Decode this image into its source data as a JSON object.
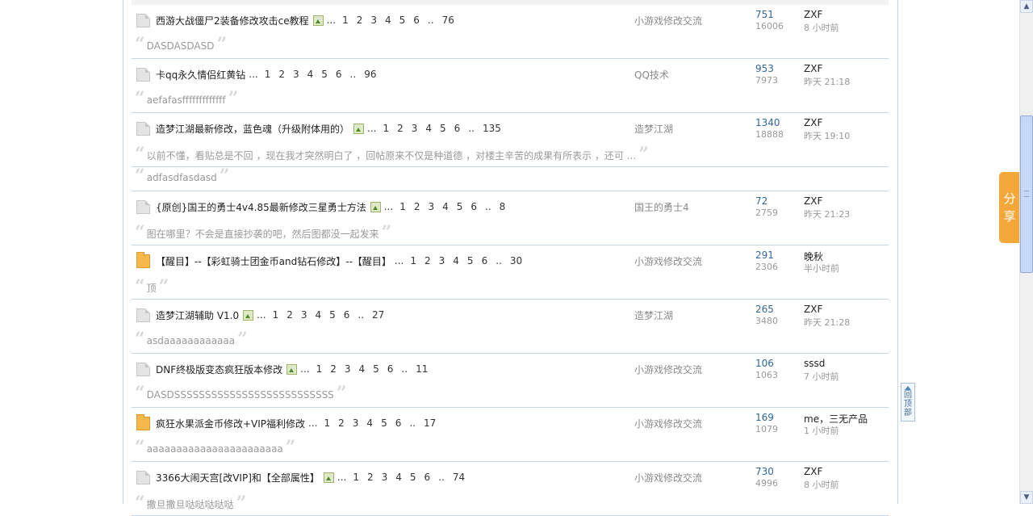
{
  "threads": [
    {
      "title": "西游大战僵尸2装备修改攻击ce教程",
      "has_image": true,
      "pages": [
        "1",
        "2",
        "3",
        "4",
        "5",
        "6",
        "..",
        "76"
      ],
      "forum": "小游戏修改交流",
      "replies": "751",
      "views": "16006",
      "author": "ZXF",
      "time": "8 小时前",
      "icon": "normal",
      "quote": "DASDASDASD"
    },
    {
      "title": "卡qq永久情侣红黄钻",
      "has_image": false,
      "pages": [
        "1",
        "2",
        "3",
        "4",
        "5",
        "6",
        "..",
        "96"
      ],
      "forum": "QQ技术",
      "replies": "953",
      "views": "7973",
      "author": "ZXF",
      "time": "昨天 21:18",
      "icon": "normal",
      "quote": "aefafasfffffffffffff"
    },
    {
      "title": "造梦江湖最新修改，蓝色魂（升级附体用的）",
      "has_image": true,
      "pages": [
        "1",
        "2",
        "3",
        "4",
        "5",
        "6",
        "..",
        "135"
      ],
      "forum": "造梦江湖",
      "replies": "1340",
      "views": "18888",
      "author": "ZXF",
      "time": "昨天 19:10",
      "icon": "normal",
      "quote": "以前不懂，看贴总是不回 ，现在我才突然明白了 ，回帖原来不仅是种道德 ，对楼主辛苦的成果有所表示 ，还可 ..."
    },
    {
      "title": "{原创}国王的勇士4v4.85最新修改三星勇士方法",
      "has_image": true,
      "pages": [
        "1",
        "2",
        "3",
        "4",
        "5",
        "6",
        "..",
        "8"
      ],
      "forum": "国王的勇士4",
      "replies": "72",
      "views": "2759",
      "author": "ZXF",
      "time": "昨天 21:23",
      "icon": "normal",
      "quote": "图在哪里？不会是直接抄袭的吧，然后图都没一起发来"
    },
    {
      "title": "【醒目】--【彩虹骑士团金币and钻石修改】--【醒目】",
      "has_image": false,
      "pages": [
        "1",
        "2",
        "3",
        "4",
        "5",
        "6",
        "..",
        "30"
      ],
      "forum": "小游戏修改交流",
      "replies": "291",
      "views": "2306",
      "author": "晚秋",
      "time": "半小时前",
      "icon": "hot",
      "quote": "顶"
    },
    {
      "title": "造梦江湖辅助 V1.0",
      "has_image": true,
      "pages": [
        "1",
        "2",
        "3",
        "4",
        "5",
        "6",
        "..",
        "27"
      ],
      "forum": "造梦江湖",
      "replies": "265",
      "views": "3480",
      "author": "ZXF",
      "time": "昨天 21:28",
      "icon": "normal",
      "quote": "asdaaaaaaaaaaaa"
    },
    {
      "title": "DNF终极版变态疯狂版本修改",
      "has_image": true,
      "pages": [
        "1",
        "2",
        "3",
        "4",
        "5",
        "6",
        "..",
        "11"
      ],
      "forum": "小游戏修改交流",
      "replies": "106",
      "views": "1063",
      "author": "sssd",
      "time": "7 小时前",
      "icon": "normal",
      "quote": "DASDSSSSSSSSSSSSSSSSSSSSSSSSSS"
    },
    {
      "title": "疯狂水果派金币修改+VIP福利修改",
      "has_image": false,
      "pages": [
        "1",
        "2",
        "3",
        "4",
        "5",
        "6",
        "..",
        "17"
      ],
      "forum": "小游戏修改交流",
      "replies": "169",
      "views": "1079",
      "author": "me，三无产品",
      "time": "1 小时前",
      "icon": "hot",
      "quote": "aaaaaaaaaaaaaaaaaaaaaaa"
    },
    {
      "title": "3366大闹天宫[改VIP]和【全部属性】",
      "has_image": true,
      "pages": [
        "1",
        "2",
        "3",
        "4",
        "5",
        "6",
        "..",
        "74"
      ],
      "forum": "小游戏修改交流",
      "replies": "730",
      "views": "4996",
      "author": "ZXF",
      "time": "8 小时前",
      "icon": "normal",
      "quote": "撒旦撒旦哒哒哒哒哒"
    }
  ],
  "extra_quote_after_3": "adfasdfasdasd",
  "ellipsis": "...",
  "share_label": [
    "分",
    "享"
  ],
  "back_to_top": [
    "回",
    "顶",
    "部"
  ]
}
